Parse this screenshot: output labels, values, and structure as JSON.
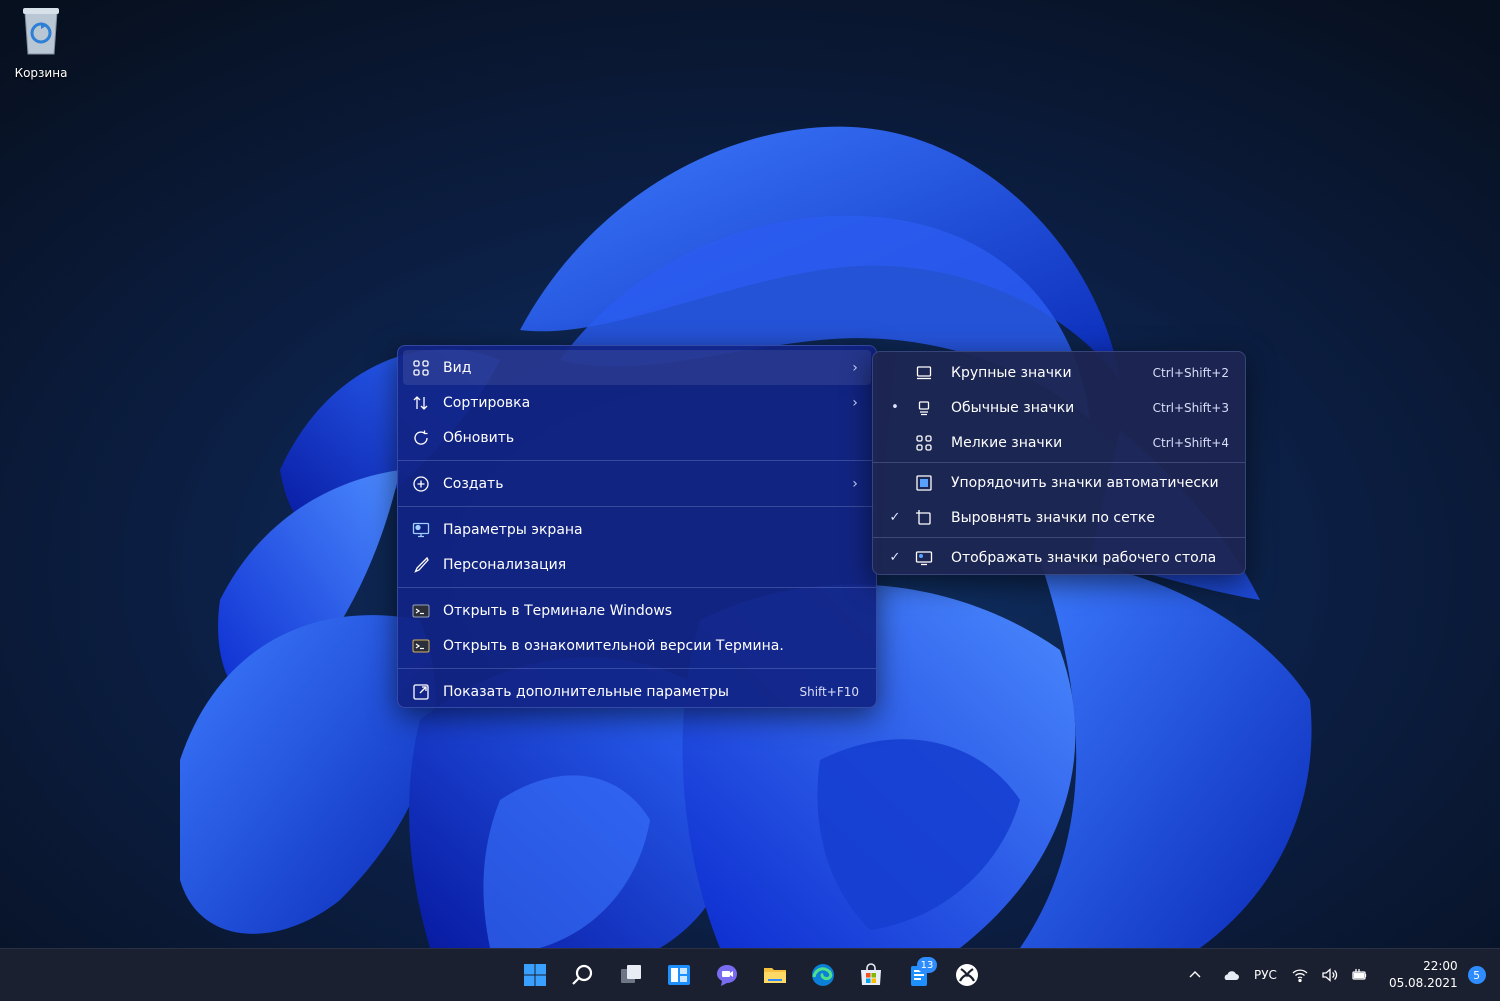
{
  "desktop": {
    "recycle_bin_label": "Корзина"
  },
  "context_menu": {
    "items": [
      {
        "label": "Вид",
        "icon": "view-grid-icon",
        "submenu": true
      },
      {
        "label": "Сортировка",
        "icon": "sort-arrows-icon",
        "submenu": true
      },
      {
        "label": "Обновить",
        "icon": "refresh-icon"
      },
      {
        "label": "Создать",
        "icon": "new-plus-icon",
        "submenu": true
      },
      {
        "label": "Параметры экрана",
        "icon": "display-settings-icon"
      },
      {
        "label": "Персонализация",
        "icon": "pen-brush-icon"
      },
      {
        "label": "Открыть в Терминале Windows",
        "icon": "terminal-icon"
      },
      {
        "label": "Открыть в ознакомительной версии Термина.",
        "icon": "terminal-preview-icon"
      },
      {
        "label": "Показать дополнительные параметры",
        "icon": "more-options-icon",
        "shortcut": "Shift+F10"
      }
    ]
  },
  "view_submenu": {
    "items": [
      {
        "label": "Крупные значки",
        "shortcut": "Ctrl+Shift+2",
        "icon": "large-icons-icon",
        "mark": ""
      },
      {
        "label": "Обычные значки",
        "shortcut": "Ctrl+Shift+3",
        "icon": "medium-icons-icon",
        "mark": "•"
      },
      {
        "label": "Мелкие значки",
        "shortcut": "Ctrl+Shift+4",
        "icon": "small-icons-icon",
        "mark": ""
      },
      {
        "label": "Упорядочить значки автоматически",
        "icon": "auto-arrange-icon",
        "mark": ""
      },
      {
        "label": "Выровнять значки по сетке",
        "icon": "align-grid-icon",
        "mark": "✓"
      },
      {
        "label": "Отображать значки рабочего стола",
        "icon": "show-desktop-icons-icon",
        "mark": "✓"
      }
    ]
  },
  "taskbar": {
    "apps": [
      "start-icon",
      "search-icon",
      "task-view-icon",
      "widgets-icon",
      "chat-icon",
      "file-explorer-icon",
      "edge-icon",
      "store-icon",
      "todo-icon",
      "xbox-icon"
    ],
    "todo_badge": "13",
    "tray": {
      "language": "РУС",
      "time": "22:00",
      "date": "05.08.2021",
      "notifications": "5"
    }
  },
  "colors": {
    "menu_bg": "#112484",
    "submenu_bg": "#1e2652",
    "taskbar_bg": "#1b2030",
    "accent": "#2e8cff"
  }
}
